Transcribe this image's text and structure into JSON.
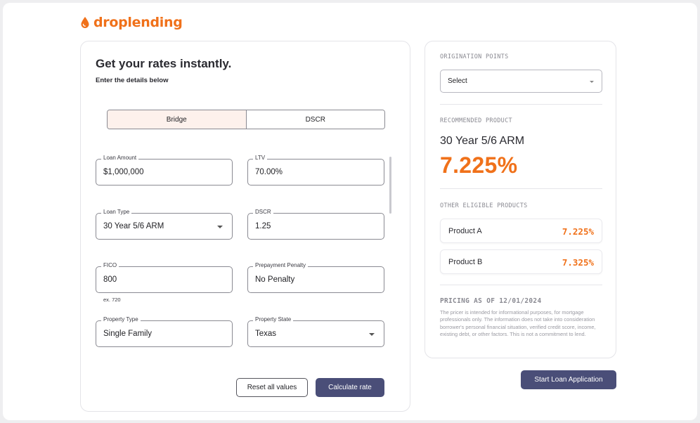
{
  "brand": {
    "name": "droplending",
    "accent": "#f0711a"
  },
  "form": {
    "title": "Get your rates instantly.",
    "subtitle": "Enter the details below",
    "toggle": {
      "options": [
        "Bridge",
        "DSCR"
      ],
      "selected": "Bridge"
    },
    "fields": {
      "loan_amount": {
        "label": "Loan Amount",
        "value": "$1,000,000"
      },
      "ltv": {
        "label": "LTV",
        "value": "70.00%"
      },
      "loan_type": {
        "label": "Loan Type",
        "value": "30 Year 5/6 ARM"
      },
      "dscr": {
        "label": "DSCR",
        "value": "1.25"
      },
      "fico": {
        "label": "FICO",
        "value": "800",
        "helper": "ex. 720"
      },
      "prepayment_penalty": {
        "label": "Prepayment Penalty",
        "value": "No Penalty"
      },
      "property_type": {
        "label": "Property Type",
        "value": "Single Family"
      },
      "property_state": {
        "label": "Property State",
        "value": "Texas"
      }
    },
    "reset_label": "Reset all values",
    "calculate_label": "Calculate rate"
  },
  "sidebar": {
    "origination_label": "ORIGINATION POINTS",
    "origination_select": "Select",
    "recommended_label": "RECOMMENDED PRODUCT",
    "recommended_name": "30 Year 5/6 ARM",
    "recommended_rate": "7.225%",
    "other_label": "OTHER ELIGIBLE PRODUCTS",
    "products": [
      {
        "name": "Product A",
        "rate": "7.225%"
      },
      {
        "name": "Product B",
        "rate": "7.325%"
      }
    ],
    "pricing_as_of": "PRICING AS OF 12/01/2024",
    "disclaimer": "The pricer is intended for informational purposes, for mortgage professionals only. The information does not take into consideration borrower's personal financial situation, verified credit score, income, existing debt, or other factors. This is not a commitment to lend."
  },
  "start_application_label": "Start Loan Application",
  "icons": {
    "logo": "droplet-icon",
    "dropdown": "chevron-down-icon"
  },
  "colors": {
    "accent": "#f0711a",
    "primary_button": "#4a4e78",
    "selected_toggle": "#fdf1ec"
  }
}
